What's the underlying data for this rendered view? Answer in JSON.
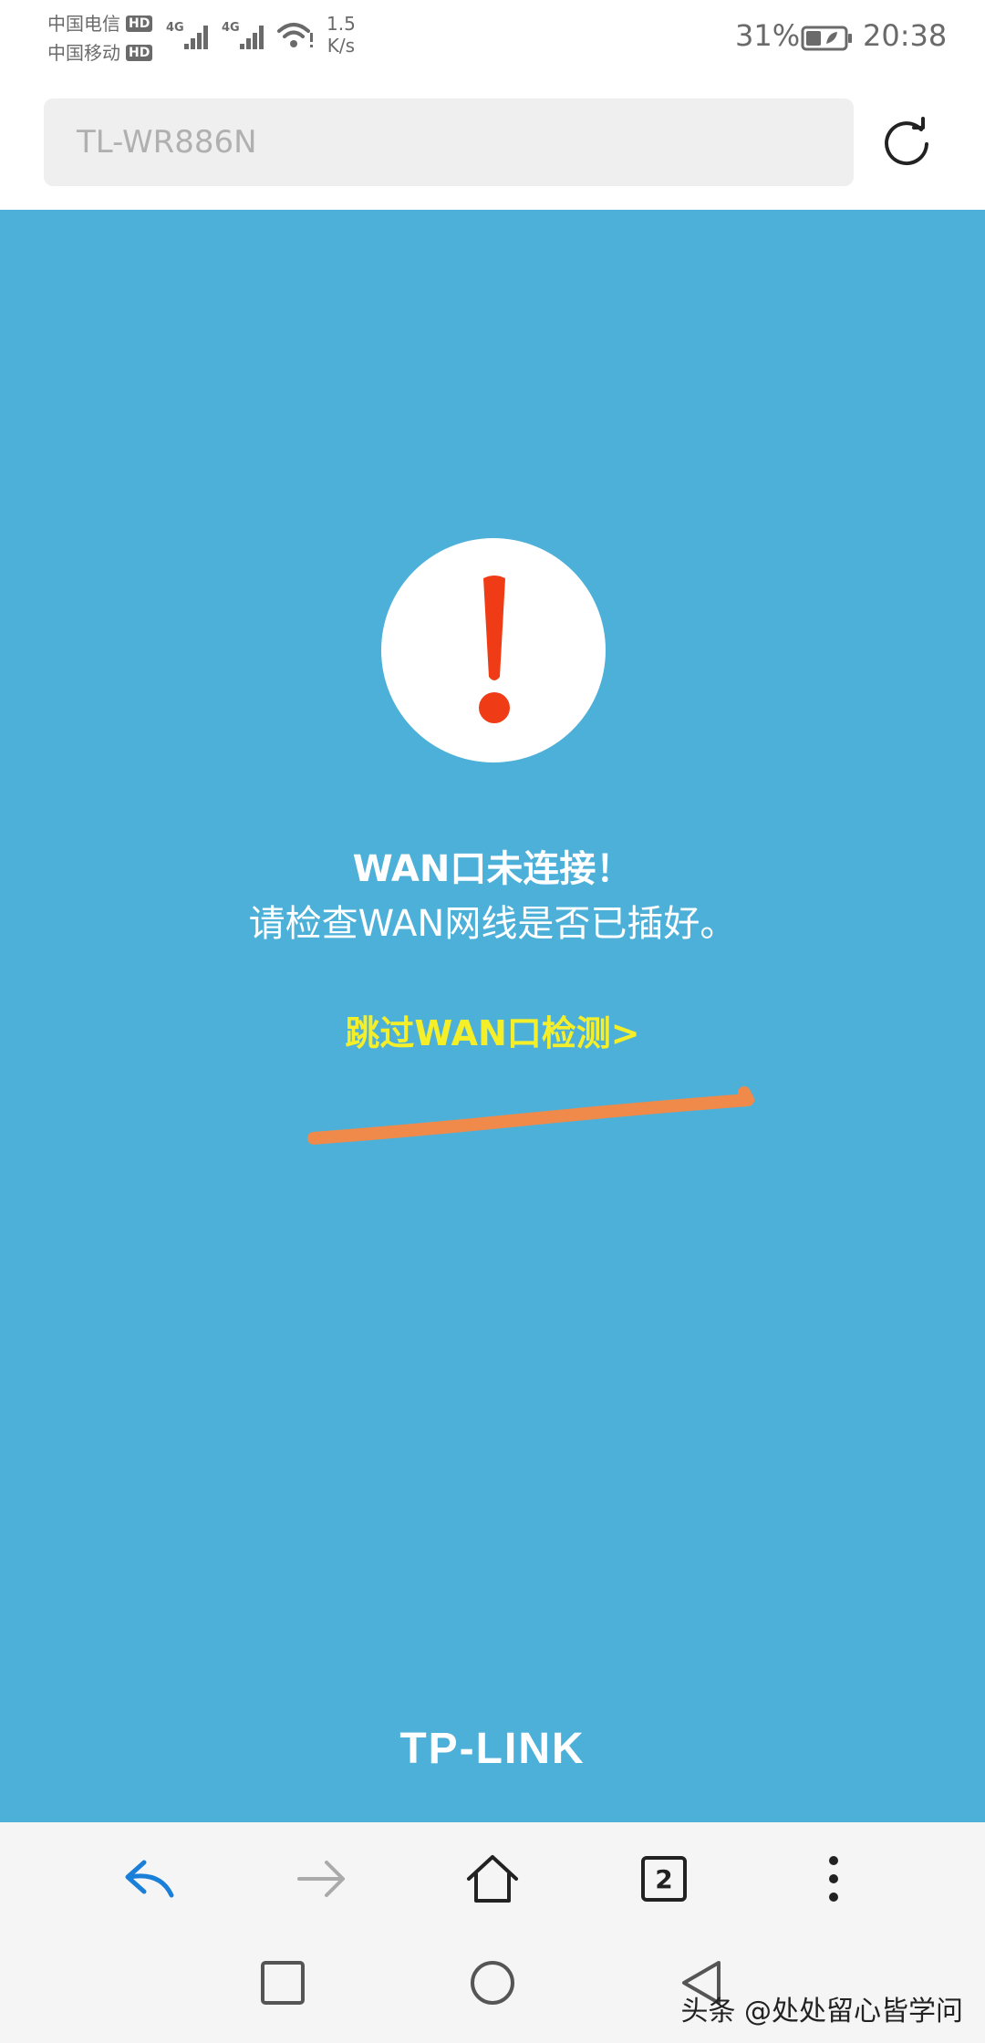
{
  "status_bar": {
    "carrier_1": "中国电信",
    "carrier_2": "中国移动",
    "hd_badge": "HD",
    "network_type": "4G",
    "speed_value": "1.5",
    "speed_unit": "K/s",
    "battery_percent": "31%",
    "time": "20:38"
  },
  "url_bar": {
    "url_text": "TL-WR886N"
  },
  "message": {
    "title": "WAN口未连接！",
    "subtitle": "请检查WAN网线是否已插好。",
    "skip_link": "跳过WAN口检测>"
  },
  "brand": {
    "logo_text": "TP-LINK"
  },
  "toolbar": {
    "tab_count": "2"
  },
  "watermark": "头条 @处处留心皆学问",
  "colors": {
    "content_bg": "#4db0d9",
    "alert_red": "#f03c16",
    "link_yellow": "#f5ef2a",
    "annotation_orange": "#f08a4b",
    "back_blue": "#1a7fd8"
  }
}
